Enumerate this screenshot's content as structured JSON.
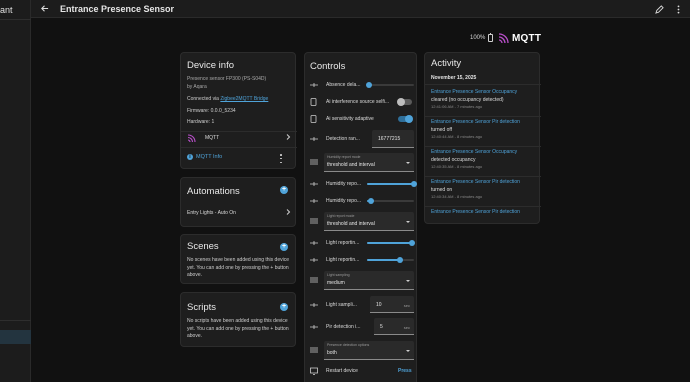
{
  "sidebar": {
    "title_fragment": "ant"
  },
  "topbar": {
    "title": "Entrance Presence Sensor",
    "icons": [
      "arrow-left-icon",
      "pencil-icon",
      "more-vertical-icon"
    ]
  },
  "header": {
    "battery": "100%",
    "integration": "MQTT"
  },
  "device_info": {
    "title": "Device info",
    "model": "Presence sensor FP300 (PS-S04D)",
    "by": "by Aqara",
    "connected_prefix": "Connected via",
    "connected_link": "Zigbee2MQTT Bridge",
    "firmware": "Firmware: 0.0.0_5234",
    "hardware": "Hardware: 1",
    "mqtt_label": "MQTT",
    "mqtt_info": "MQTT Info"
  },
  "automations": {
    "title": "Automations",
    "items": [
      "Entry Lights - Auto On"
    ]
  },
  "scenes": {
    "title": "Scenes",
    "text": "No scenes have been added using this device yet. You can add one by pressing the + button above."
  },
  "scripts": {
    "title": "Scripts",
    "text": "No scripts have been added using this device yet. You can add one by pressing the + button above."
  },
  "controls": {
    "title": "Controls",
    "items": [
      {
        "label": "Absence dela...",
        "type": "slider",
        "value": 0.05
      },
      {
        "label": "Ai interference source selfi...",
        "type": "toggle",
        "on": false
      },
      {
        "label": "Ai sensitivity adaptive",
        "type": "toggle",
        "on": true
      },
      {
        "label": "Detection ran...",
        "type": "number",
        "value": "16777215"
      },
      {
        "label": "Humidity report mode",
        "type": "select",
        "value": "threshold and interval"
      },
      {
        "label": "Humidity repo...",
        "type": "slider",
        "value": 1.0
      },
      {
        "label": "Humidity repo...",
        "type": "slider",
        "value": 0.08
      },
      {
        "label": "Light report mode",
        "type": "select",
        "value": "threshold and interval"
      },
      {
        "label": "Light reportin...",
        "type": "slider",
        "value": 0.96
      },
      {
        "label": "Light reportin...",
        "type": "slider",
        "value": 0.7
      },
      {
        "label": "Light sampling",
        "type": "select",
        "value": "medium"
      },
      {
        "label": "Light sampli...",
        "type": "number",
        "value": "10",
        "unit": "sec"
      },
      {
        "label": "Pir detection i...",
        "type": "number",
        "value": "5",
        "unit": "sec"
      },
      {
        "label": "Presence detection options",
        "type": "select",
        "value": "both"
      },
      {
        "label": "Restart device",
        "type": "button",
        "value": "Press"
      }
    ]
  },
  "activity": {
    "title": "Activity",
    "date": "November 15, 2025",
    "items": [
      {
        "title": "Entrance Presence Sensor Occupancy",
        "desc": "cleared (no occupancy detected)",
        "time": "12:41:06 AM - 7 minutes ago"
      },
      {
        "title": "Entrance Presence Sensor Pir detection",
        "desc": "turned off",
        "time": "12:40:44 AM - 8 minutes ago"
      },
      {
        "title": "Entrance Presence Sensor Occupancy",
        "desc": "detected occupancy",
        "time": "12:40:35 AM - 8 minutes ago"
      },
      {
        "title": "Entrance Presence Sensor Pir detection",
        "desc": "turned on",
        "time": "12:40:34 AM - 8 minutes ago"
      },
      {
        "title": "Entrance Presence Sensor Pir detection",
        "desc": "",
        "time": ""
      }
    ]
  },
  "colors": {
    "accent": "#4fa3d9",
    "card": "#1e1e1e",
    "background": "#111111"
  }
}
